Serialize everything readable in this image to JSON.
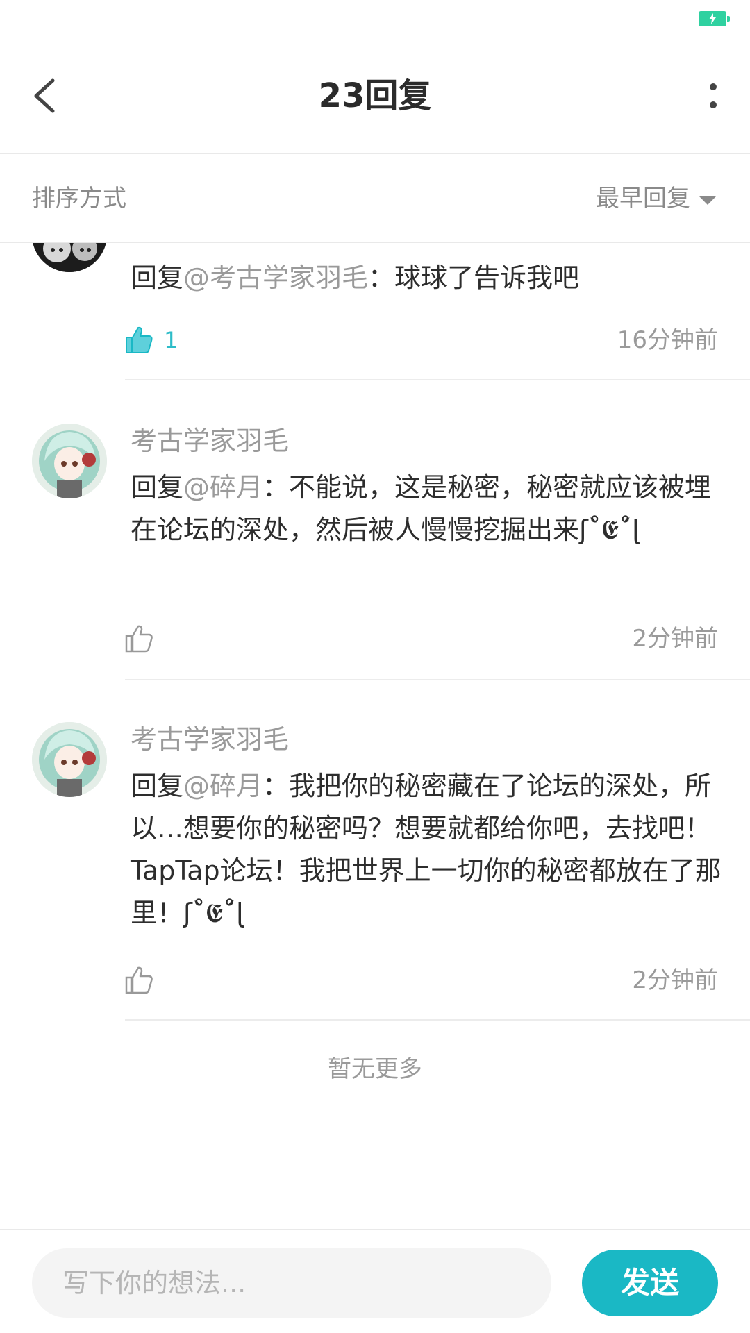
{
  "header": {
    "title": "23回复"
  },
  "sort": {
    "label": "排序方式",
    "value": "最早回复"
  },
  "replies": [
    {
      "username": "",
      "prefix": "回复",
      "mention": "@考古学家羽毛",
      "separator": "：",
      "text": "球球了告诉我吧",
      "likes": "1",
      "liked": true,
      "time": "16分钟前"
    },
    {
      "username": "考古学家羽毛",
      "prefix": "回复",
      "mention": "@碎月",
      "separator": "：",
      "text": "不能说，这是秘密，秘密就应该被埋在论坛的深处，然后被人慢慢挖掘出来ʃ˚̀𝕰˚́ɭ",
      "likes": "",
      "liked": false,
      "time": "2分钟前"
    },
    {
      "username": "考古学家羽毛",
      "prefix": "回复",
      "mention": "@碎月",
      "separator": "：",
      "text": "我把你的秘密藏在了论坛的深处，所以…想要你的秘密吗？想要就都给你吧，去找吧！TapTap论坛！我把世界上一切你的秘密都放在了那里！ʃ˚̀𝕰˚́ɭ",
      "likes": "",
      "liked": false,
      "time": "2分钟前"
    }
  ],
  "footer_note": "暂无更多",
  "composer": {
    "placeholder": "写下你的想法...",
    "send_label": "发送"
  },
  "colors": {
    "accent": "#1ab8c5",
    "battery": "#2fd1a0",
    "muted_text": "#9a9a9a"
  }
}
